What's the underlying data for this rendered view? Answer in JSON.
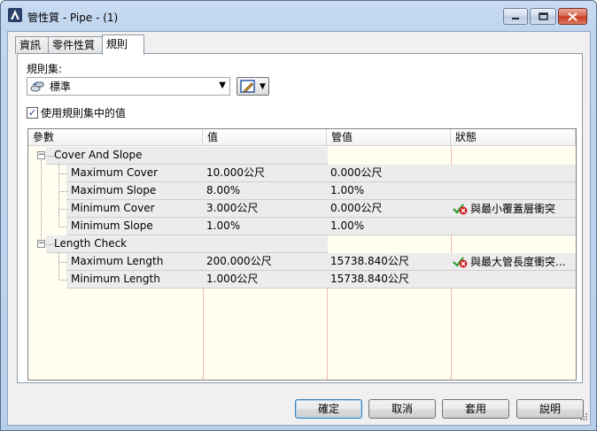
{
  "window": {
    "title": "管性質 - Pipe - (1)"
  },
  "tabs": [
    {
      "label": "資訊",
      "active": false
    },
    {
      "label": "零件性質",
      "active": false
    },
    {
      "label": "規則",
      "active": true
    }
  ],
  "ruleset": {
    "label": "規則集:",
    "selected": "標準"
  },
  "use_ruleset_values": {
    "label": "使用規則集中的值",
    "checked": true
  },
  "grid": {
    "columns": [
      "參數",
      "值",
      "管值",
      "狀態"
    ],
    "groups": [
      {
        "name": "Cover And Slope",
        "rows": [
          {
            "param": "Maximum Cover",
            "value": "10.000公尺",
            "pipe_value": "0.000公尺",
            "status": ""
          },
          {
            "param": "Maximum Slope",
            "value": "8.00%",
            "pipe_value": "1.00%",
            "status": ""
          },
          {
            "param": "Minimum Cover",
            "value": "3.000公尺",
            "pipe_value": "0.000公尺",
            "status": "與最小覆蓋層衝突"
          },
          {
            "param": "Minimum Slope",
            "value": "1.00%",
            "pipe_value": "1.00%",
            "status": ""
          }
        ]
      },
      {
        "name": "Length Check",
        "rows": [
          {
            "param": "Maximum Length",
            "value": "200.000公尺",
            "pipe_value": "15738.840公尺",
            "status": "與最大管長度衝突..."
          },
          {
            "param": "Minimum Length",
            "value": "1.000公尺",
            "pipe_value": "15738.840公尺",
            "status": ""
          }
        ]
      }
    ]
  },
  "buttons": {
    "ok": "確定",
    "cancel": "取消",
    "apply": "套用",
    "help": "說明"
  },
  "colors": {
    "grid_background": "#fffef0",
    "warning_x": "#d32020",
    "check_green": "#2d9a2d"
  }
}
